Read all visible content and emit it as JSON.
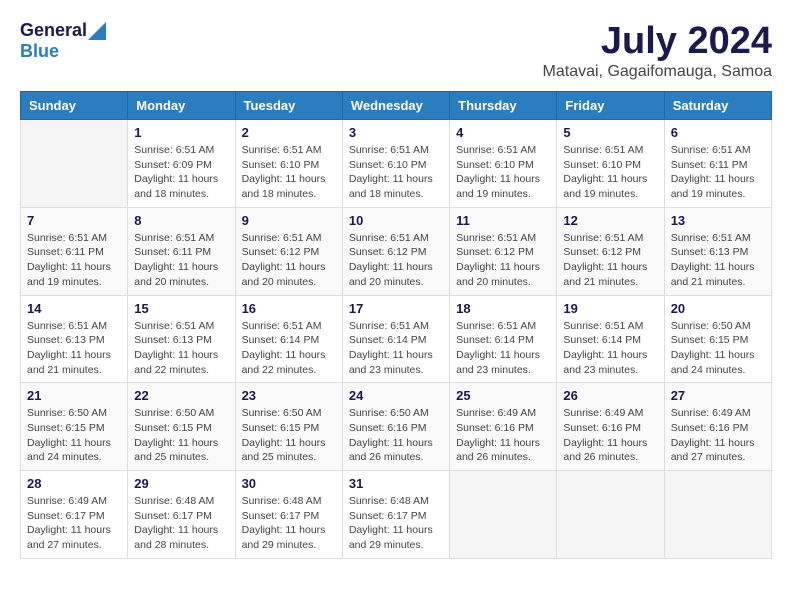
{
  "header": {
    "logo_general": "General",
    "logo_blue": "Blue",
    "main_title": "July 2024",
    "subtitle": "Matavai, Gagaifomauga, Samoa"
  },
  "calendar": {
    "days_of_week": [
      "Sunday",
      "Monday",
      "Tuesday",
      "Wednesday",
      "Thursday",
      "Friday",
      "Saturday"
    ],
    "weeks": [
      [
        {
          "date": "",
          "info": ""
        },
        {
          "date": "1",
          "info": "Sunrise: 6:51 AM\nSunset: 6:09 PM\nDaylight: 11 hours\nand 18 minutes."
        },
        {
          "date": "2",
          "info": "Sunrise: 6:51 AM\nSunset: 6:10 PM\nDaylight: 11 hours\nand 18 minutes."
        },
        {
          "date": "3",
          "info": "Sunrise: 6:51 AM\nSunset: 6:10 PM\nDaylight: 11 hours\nand 18 minutes."
        },
        {
          "date": "4",
          "info": "Sunrise: 6:51 AM\nSunset: 6:10 PM\nDaylight: 11 hours\nand 19 minutes."
        },
        {
          "date": "5",
          "info": "Sunrise: 6:51 AM\nSunset: 6:10 PM\nDaylight: 11 hours\nand 19 minutes."
        },
        {
          "date": "6",
          "info": "Sunrise: 6:51 AM\nSunset: 6:11 PM\nDaylight: 11 hours\nand 19 minutes."
        }
      ],
      [
        {
          "date": "7",
          "info": "Sunrise: 6:51 AM\nSunset: 6:11 PM\nDaylight: 11 hours\nand 19 minutes."
        },
        {
          "date": "8",
          "info": "Sunrise: 6:51 AM\nSunset: 6:11 PM\nDaylight: 11 hours\nand 20 minutes."
        },
        {
          "date": "9",
          "info": "Sunrise: 6:51 AM\nSunset: 6:12 PM\nDaylight: 11 hours\nand 20 minutes."
        },
        {
          "date": "10",
          "info": "Sunrise: 6:51 AM\nSunset: 6:12 PM\nDaylight: 11 hours\nand 20 minutes."
        },
        {
          "date": "11",
          "info": "Sunrise: 6:51 AM\nSunset: 6:12 PM\nDaylight: 11 hours\nand 20 minutes."
        },
        {
          "date": "12",
          "info": "Sunrise: 6:51 AM\nSunset: 6:12 PM\nDaylight: 11 hours\nand 21 minutes."
        },
        {
          "date": "13",
          "info": "Sunrise: 6:51 AM\nSunset: 6:13 PM\nDaylight: 11 hours\nand 21 minutes."
        }
      ],
      [
        {
          "date": "14",
          "info": "Sunrise: 6:51 AM\nSunset: 6:13 PM\nDaylight: 11 hours\nand 21 minutes."
        },
        {
          "date": "15",
          "info": "Sunrise: 6:51 AM\nSunset: 6:13 PM\nDaylight: 11 hours\nand 22 minutes."
        },
        {
          "date": "16",
          "info": "Sunrise: 6:51 AM\nSunset: 6:14 PM\nDaylight: 11 hours\nand 22 minutes."
        },
        {
          "date": "17",
          "info": "Sunrise: 6:51 AM\nSunset: 6:14 PM\nDaylight: 11 hours\nand 23 minutes."
        },
        {
          "date": "18",
          "info": "Sunrise: 6:51 AM\nSunset: 6:14 PM\nDaylight: 11 hours\nand 23 minutes."
        },
        {
          "date": "19",
          "info": "Sunrise: 6:51 AM\nSunset: 6:14 PM\nDaylight: 11 hours\nand 23 minutes."
        },
        {
          "date": "20",
          "info": "Sunrise: 6:50 AM\nSunset: 6:15 PM\nDaylight: 11 hours\nand 24 minutes."
        }
      ],
      [
        {
          "date": "21",
          "info": "Sunrise: 6:50 AM\nSunset: 6:15 PM\nDaylight: 11 hours\nand 24 minutes."
        },
        {
          "date": "22",
          "info": "Sunrise: 6:50 AM\nSunset: 6:15 PM\nDaylight: 11 hours\nand 25 minutes."
        },
        {
          "date": "23",
          "info": "Sunrise: 6:50 AM\nSunset: 6:15 PM\nDaylight: 11 hours\nand 25 minutes."
        },
        {
          "date": "24",
          "info": "Sunrise: 6:50 AM\nSunset: 6:16 PM\nDaylight: 11 hours\nand 26 minutes."
        },
        {
          "date": "25",
          "info": "Sunrise: 6:49 AM\nSunset: 6:16 PM\nDaylight: 11 hours\nand 26 minutes."
        },
        {
          "date": "26",
          "info": "Sunrise: 6:49 AM\nSunset: 6:16 PM\nDaylight: 11 hours\nand 26 minutes."
        },
        {
          "date": "27",
          "info": "Sunrise: 6:49 AM\nSunset: 6:16 PM\nDaylight: 11 hours\nand 27 minutes."
        }
      ],
      [
        {
          "date": "28",
          "info": "Sunrise: 6:49 AM\nSunset: 6:17 PM\nDaylight: 11 hours\nand 27 minutes."
        },
        {
          "date": "29",
          "info": "Sunrise: 6:48 AM\nSunset: 6:17 PM\nDaylight: 11 hours\nand 28 minutes."
        },
        {
          "date": "30",
          "info": "Sunrise: 6:48 AM\nSunset: 6:17 PM\nDaylight: 11 hours\nand 29 minutes."
        },
        {
          "date": "31",
          "info": "Sunrise: 6:48 AM\nSunset: 6:17 PM\nDaylight: 11 hours\nand 29 minutes."
        },
        {
          "date": "",
          "info": ""
        },
        {
          "date": "",
          "info": ""
        },
        {
          "date": "",
          "info": ""
        }
      ]
    ]
  }
}
